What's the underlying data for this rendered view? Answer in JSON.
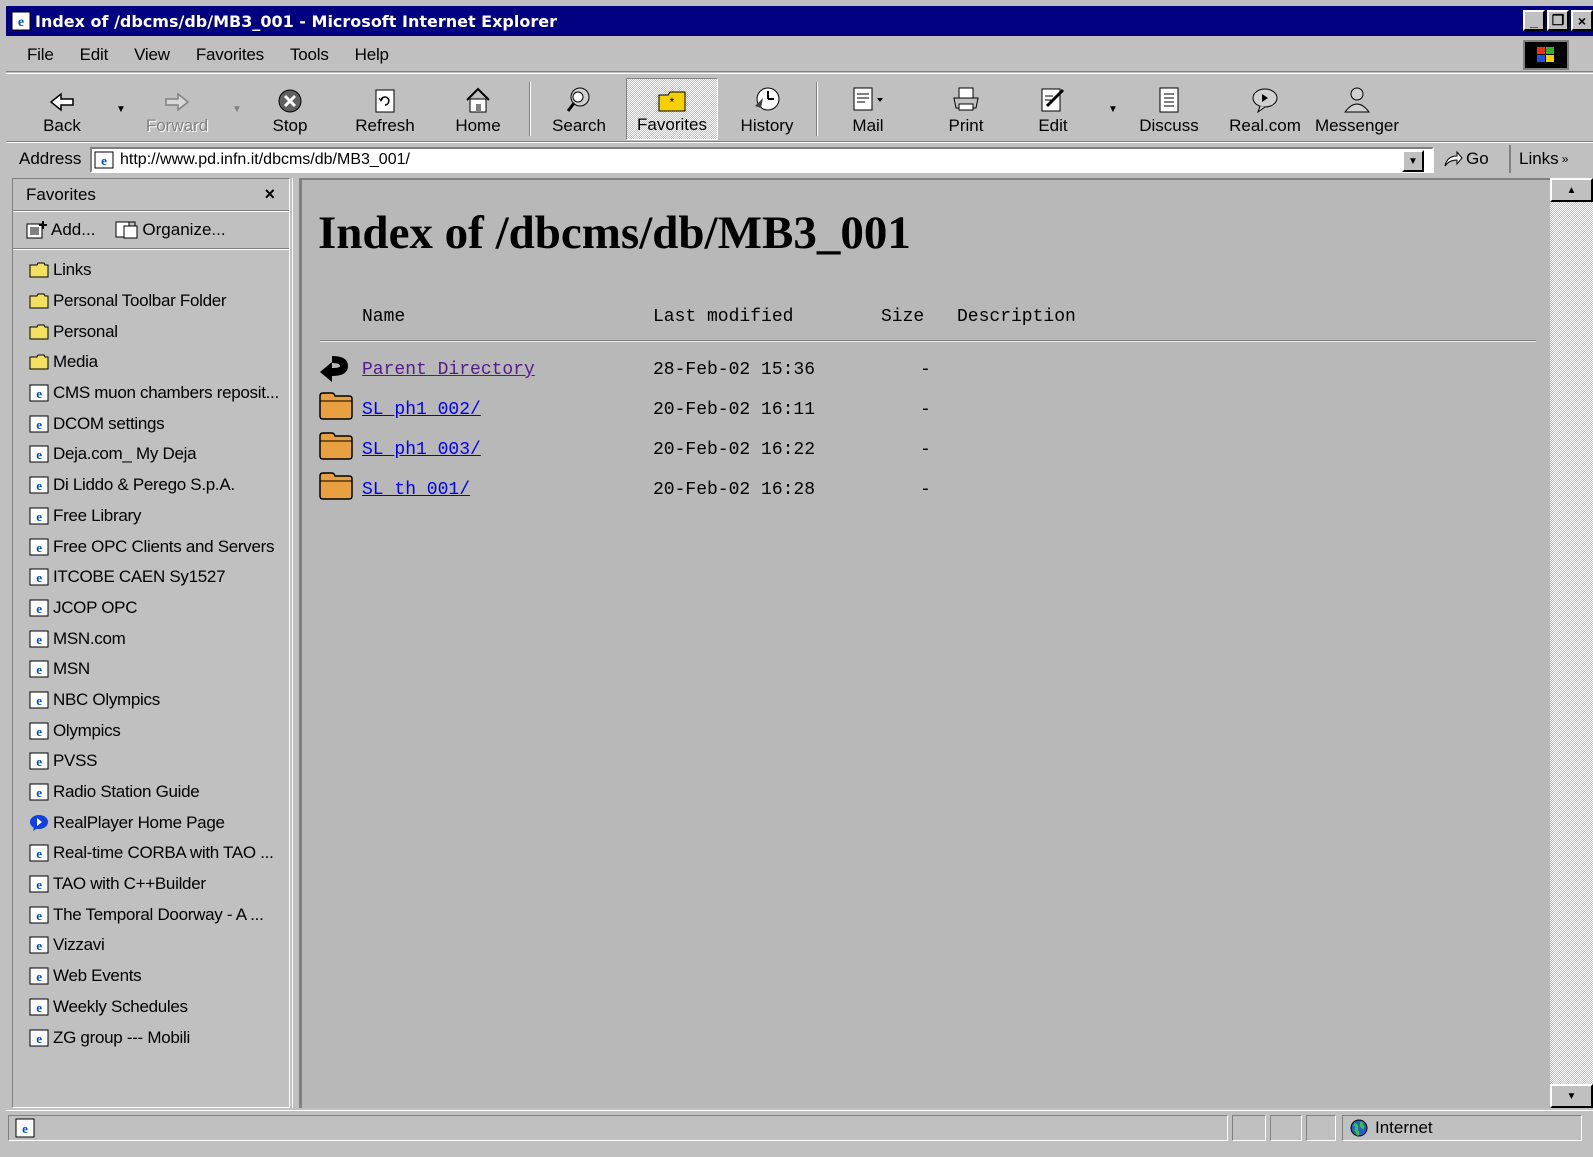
{
  "window": {
    "title": "Index of /dbcms/db/MB3_001 - Microsoft Internet Explorer",
    "controls": [
      "_",
      "❐",
      "×"
    ]
  },
  "menu": [
    "File",
    "Edit",
    "View",
    "Favorites",
    "Tools",
    "Help"
  ],
  "toolbar": {
    "back": "Back",
    "forward": "Forward",
    "stop": "Stop",
    "refresh": "Refresh",
    "home": "Home",
    "search": "Search",
    "favorites": "Favorites",
    "history": "History",
    "mail": "Mail",
    "print": "Print",
    "edit": "Edit",
    "discuss": "Discuss",
    "realcom": "Real.com",
    "messenger": "Messenger"
  },
  "address": {
    "label": "Address",
    "url": "http://www.pd.infn.it/dbcms/db/MB3_001/",
    "go": "Go",
    "links": "Links"
  },
  "favorites": {
    "title": "Favorites",
    "close": "×",
    "add": "Add...",
    "organize": "Organize...",
    "items": [
      {
        "label": "Links",
        "icon": "folder"
      },
      {
        "label": "Personal Toolbar Folder",
        "icon": "folder"
      },
      {
        "label": "Personal",
        "icon": "folder"
      },
      {
        "label": "Media",
        "icon": "folder"
      },
      {
        "label": "CMS muon chambers reposit...",
        "icon": "ie-page"
      },
      {
        "label": "DCOM settings",
        "icon": "ie-page"
      },
      {
        "label": "Deja.com_ My Deja",
        "icon": "ie-page"
      },
      {
        "label": "Di Liddo & Perego S.p.A.",
        "icon": "ie-page"
      },
      {
        "label": "Free Library",
        "icon": "ie-page"
      },
      {
        "label": "Free OPC Clients and Servers",
        "icon": "ie-page"
      },
      {
        "label": "ITCOBE CAEN Sy1527",
        "icon": "ie-page"
      },
      {
        "label": "JCOP OPC",
        "icon": "ie-page"
      },
      {
        "label": "MSN.com",
        "icon": "ie-page"
      },
      {
        "label": "MSN",
        "icon": "ie-page"
      },
      {
        "label": "NBC Olympics",
        "icon": "ie-page"
      },
      {
        "label": "Olympics",
        "icon": "ie-page"
      },
      {
        "label": "PVSS",
        "icon": "ie-page"
      },
      {
        "label": "Radio Station Guide",
        "icon": "ie-page"
      },
      {
        "label": "RealPlayer Home Page",
        "icon": "realplayer"
      },
      {
        "label": "Real-time CORBA with TAO ...",
        "icon": "ie-page"
      },
      {
        "label": "TAO with C++Builder",
        "icon": "ie-page"
      },
      {
        "label": "The Temporal Doorway - A ...",
        "icon": "ie-page"
      },
      {
        "label": "Vizzavi",
        "icon": "ie-page"
      },
      {
        "label": "Web Events",
        "icon": "ie-page"
      },
      {
        "label": "Weekly Schedules",
        "icon": "ie-page"
      },
      {
        "label": "ZG group --- Mobili",
        "icon": "ie-page"
      }
    ]
  },
  "page": {
    "title": "Index of /dbcms/db/MB3_001",
    "columns": {
      "name": "Name",
      "modified": "Last modified",
      "size": "Size",
      "description": "Description"
    },
    "rows": [
      {
        "name": "Parent Directory",
        "modified": "28-Feb-02 15:36",
        "size": "-",
        "icon": "back-arrow",
        "visited": true
      },
      {
        "name": "SL_ph1_002/",
        "modified": "20-Feb-02 16:11",
        "size": "-",
        "icon": "folder",
        "visited": false
      },
      {
        "name": "SL_ph1_003/",
        "modified": "20-Feb-02 16:22",
        "size": "-",
        "icon": "folder",
        "visited": false
      },
      {
        "name": "SL_th_001/",
        "modified": "20-Feb-02 16:28",
        "size": "-",
        "icon": "folder",
        "visited": false
      }
    ]
  },
  "status": {
    "zone": "Internet"
  },
  "colors": {
    "titlebar": "#000080",
    "link": "#0000ee",
    "visited": "#551a8b",
    "chrome": "#c0c0c0",
    "content_bg": "#b8b8b8"
  }
}
